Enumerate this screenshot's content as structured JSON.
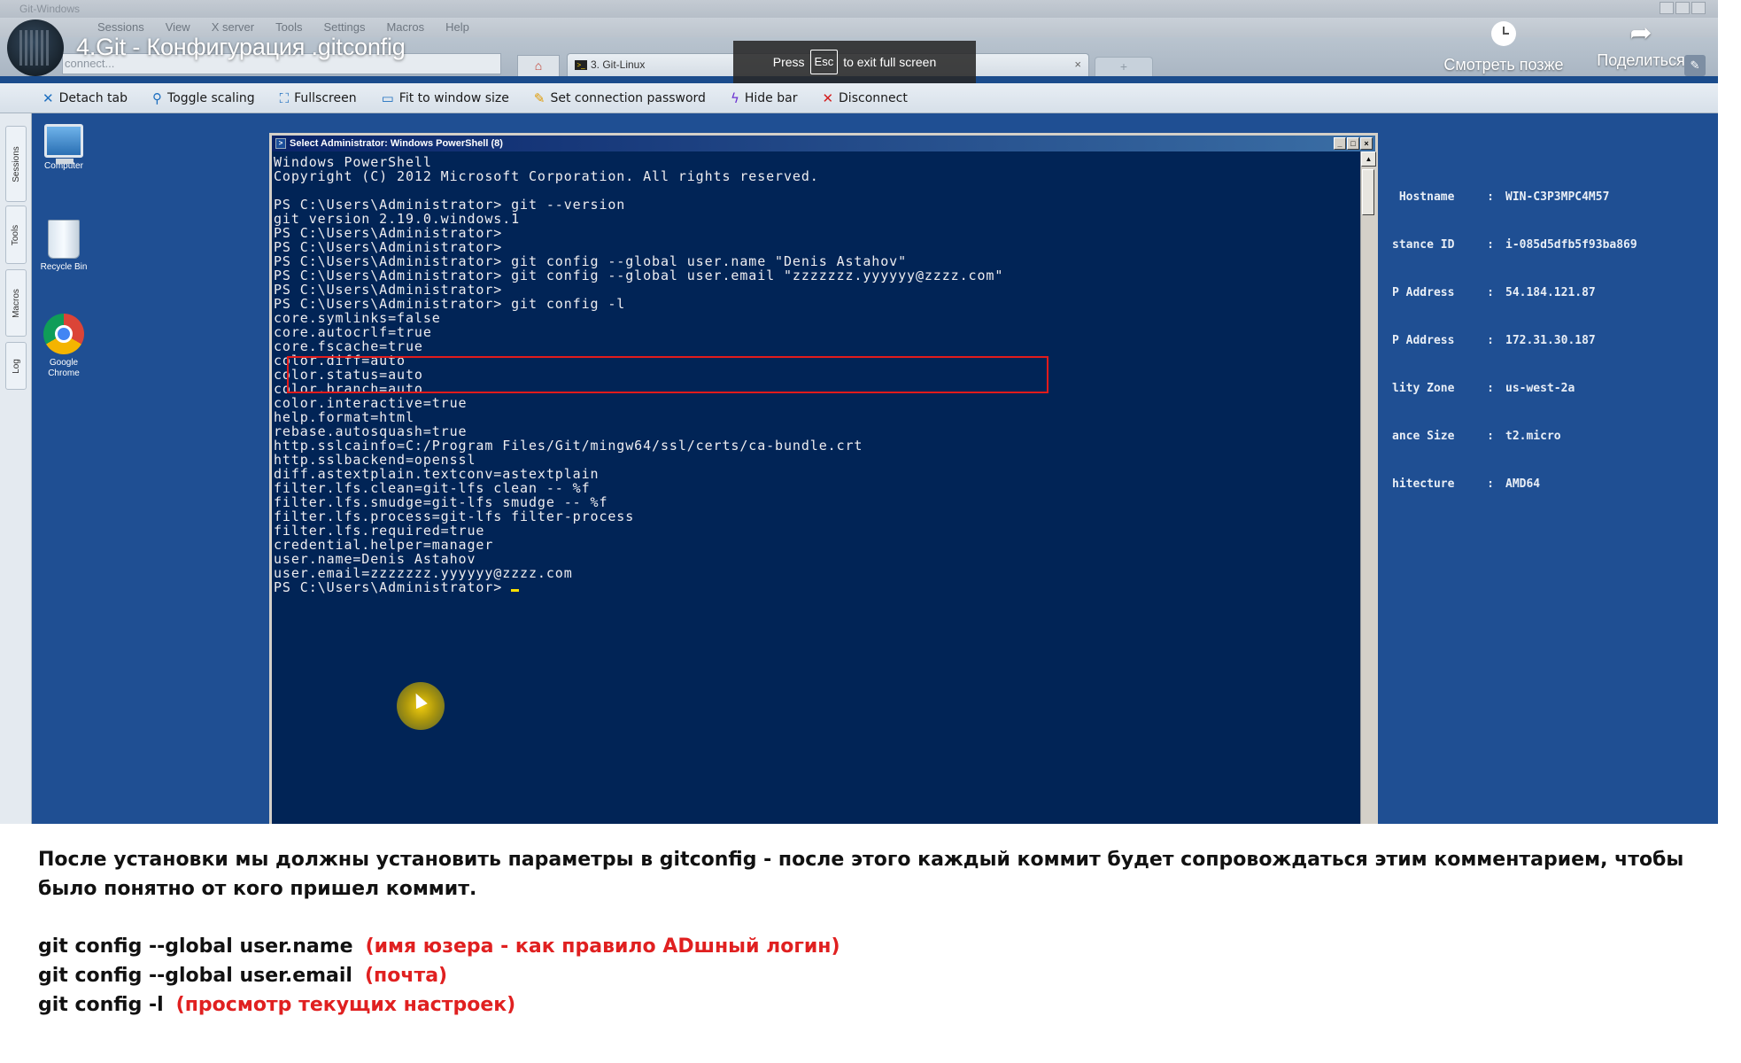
{
  "window": {
    "title": "Git-Windows"
  },
  "menu": [
    "Sessions",
    "View",
    "X server",
    "Tools",
    "Settings",
    "Macros",
    "Help"
  ],
  "quickconnect": {
    "placeholder": "connect..."
  },
  "tabs": {
    "home_icon": "home-icon",
    "active_label": "3. Git-Linux",
    "new_tab_symbol": "+"
  },
  "youtube": {
    "video_title": "4.Git - Конфигурация .gitconfig",
    "esc_banner": {
      "press": "Press",
      "key": "Esc",
      "suffix": "to exit full screen"
    },
    "watch_later": "Смотреть позже",
    "share": "Поделиться"
  },
  "toolbar": {
    "items": [
      {
        "label": "Detach tab",
        "icon": "✕",
        "color": "#1f6fbf"
      },
      {
        "label": "Toggle scaling",
        "icon": "🔍",
        "color": "#1f6fbf"
      },
      {
        "label": "Fullscreen",
        "icon": "⛶",
        "color": "#1f6fbf"
      },
      {
        "label": "Fit to window size",
        "icon": "🖥",
        "color": "#1f6fbf"
      },
      {
        "label": "Set connection password",
        "icon": "🔧",
        "color": "#e09a00"
      },
      {
        "label": "Hide bar",
        "icon": "⚡",
        "color": "#6a2fd0"
      },
      {
        "label": "Disconnect",
        "icon": "✕",
        "color": "#d32020"
      }
    ]
  },
  "side_tabs": [
    "Sessions",
    "Tools",
    "Macros",
    "Log"
  ],
  "desktop_icons": [
    {
      "label": "Computer",
      "icon": "computer-icon"
    },
    {
      "label": "Recycle Bin",
      "icon": "recycle-bin-icon"
    },
    {
      "label": "Google Chrome",
      "icon": "chrome-icon"
    }
  ],
  "system_info": [
    {
      "key": " Hostname",
      "sep": ":",
      "value": "WIN-C3P3MPC4M57"
    },
    {
      "key": "stance ID",
      "sep": ":",
      "value": "i-085d5dfb5f93ba869"
    },
    {
      "key": "P Address",
      "sep": ":",
      "value": "54.184.121.87"
    },
    {
      "key": "P Address",
      "sep": ":",
      "value": "172.31.30.187"
    },
    {
      "key": "lity Zone",
      "sep": ":",
      "value": "us-west-2a"
    },
    {
      "key": "ance Size",
      "sep": ":",
      "value": "t2.micro"
    },
    {
      "key": "hitecture",
      "sep": ":",
      "value": "AMD64"
    }
  ],
  "powershell": {
    "title": "Select Administrator: Windows PowerShell (8)",
    "lines": [
      "Windows PowerShell",
      "Copyright (C) 2012 Microsoft Corporation. All rights reserved.",
      "",
      "PS C:\\Users\\Administrator> git --version",
      "git version 2.19.0.windows.1",
      "PS C:\\Users\\Administrator>",
      "PS C:\\Users\\Administrator>",
      "PS C:\\Users\\Administrator> git config --global user.name \"Denis Astahov\"",
      "PS C:\\Users\\Administrator> git config --global user.email \"zzzzzzz.yyyyyy@zzzz.com\"",
      "PS C:\\Users\\Administrator>",
      "PS C:\\Users\\Administrator> git config -l",
      "core.symlinks=false",
      "core.autocrlf=true",
      "core.fscache=true",
      "color.diff=auto",
      "color.status=auto",
      "color.branch=auto",
      "color.interactive=true",
      "help.format=html",
      "rebase.autosquash=true",
      "http.sslcainfo=C:/Program Files/Git/mingw64/ssl/certs/ca-bundle.crt",
      "http.sslbackend=openssl",
      "diff.astextplain.textconv=astextplain",
      "filter.lfs.clean=git-lfs clean -- %f",
      "filter.lfs.smudge=git-lfs smudge -- %f",
      "filter.lfs.process=git-lfs filter-process",
      "filter.lfs.required=true",
      "credential.helper=manager",
      "user.name=Denis Astahov",
      "user.email=zzzzzzz.yyyyyy@zzzz.com",
      "PS C:\\Users\\Administrator> "
    ]
  },
  "caption": {
    "paragraph": "После установки мы должны установить параметры в gitconfig - после этого каждый коммит будет сопровождаться этим комментарием, чтобы было понятно от кого пришел коммит.",
    "commands": [
      {
        "command": "git config --global user.name",
        "note": "(имя юзера - как правило ADшный логин)"
      },
      {
        "command": "git config --global user.email",
        "note": "(почта)"
      },
      {
        "command": "git config -l",
        "note": "(просмотр текущих настроек)"
      }
    ],
    "note_color": "#e02020"
  }
}
